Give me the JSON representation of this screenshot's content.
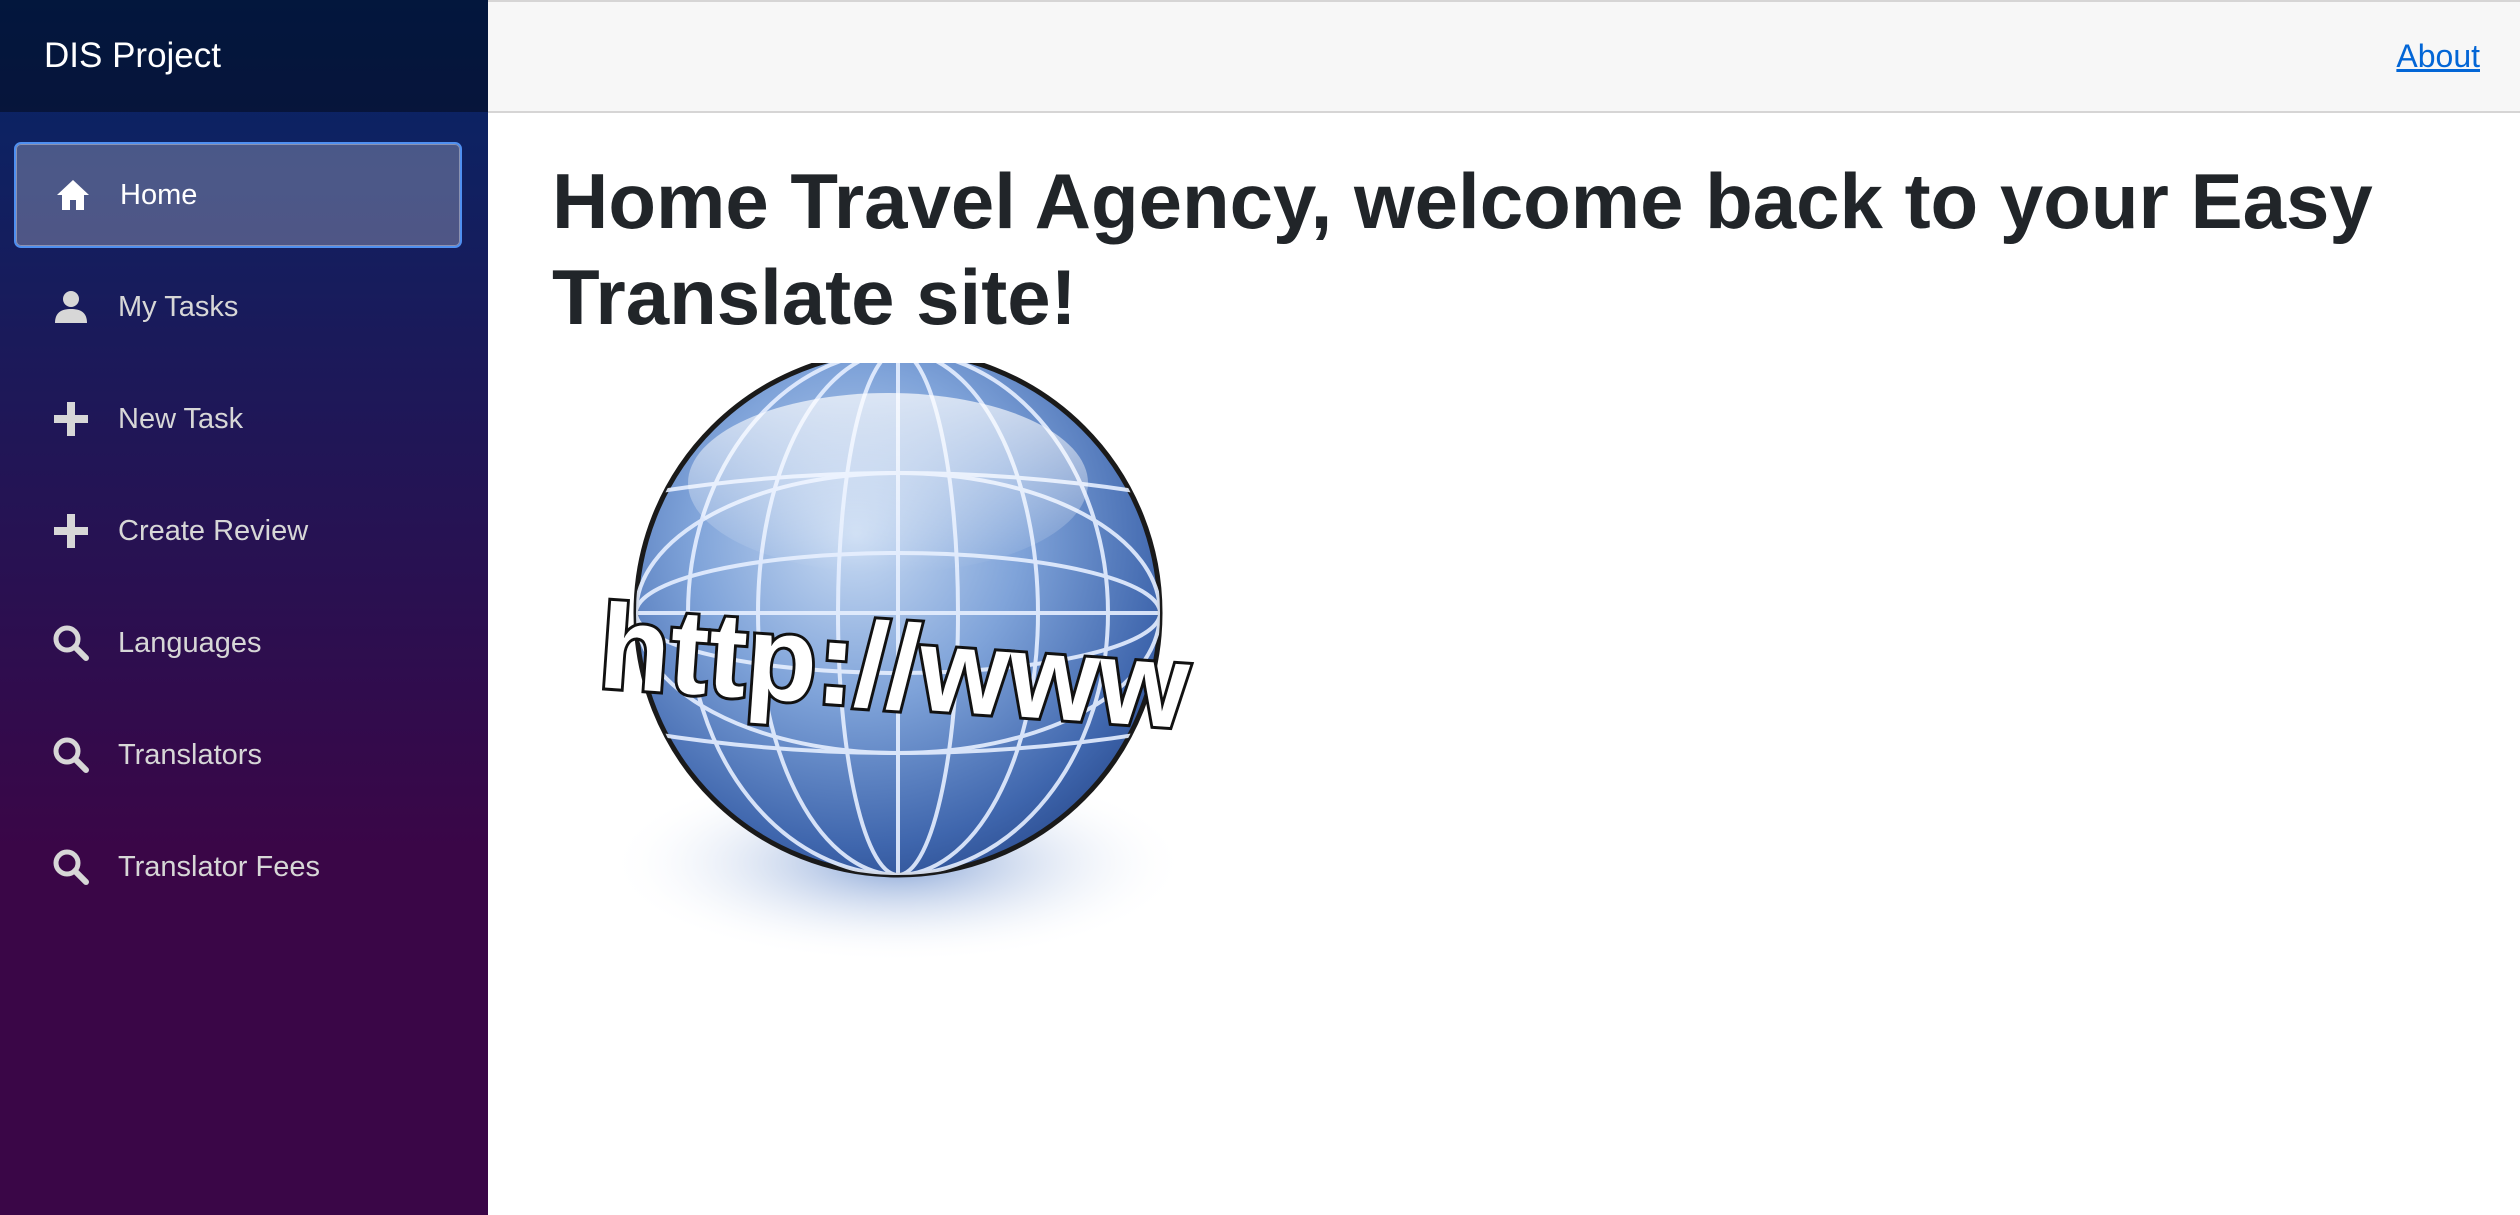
{
  "sidebar": {
    "brand": "DIS Project",
    "items": [
      {
        "label": "Home",
        "icon": "home-icon",
        "active": true
      },
      {
        "label": "My Tasks",
        "icon": "person-icon",
        "active": false
      },
      {
        "label": "New Task",
        "icon": "plus-icon",
        "active": false
      },
      {
        "label": "Create Review",
        "icon": "plus-icon",
        "active": false
      },
      {
        "label": "Languages",
        "icon": "search-icon",
        "active": false
      },
      {
        "label": "Translators",
        "icon": "search-icon",
        "active": false
      },
      {
        "label": "Translator Fees",
        "icon": "search-icon",
        "active": false
      }
    ]
  },
  "header": {
    "about_label": "About"
  },
  "main": {
    "title": "Home Travel Agency, welcome back to your Easy Translate site!",
    "image_text": "http://www"
  },
  "colors": {
    "sidebar_top": "#052767",
    "sidebar_bottom": "#3a0647",
    "link": "#0366d6",
    "title": "#212529"
  }
}
